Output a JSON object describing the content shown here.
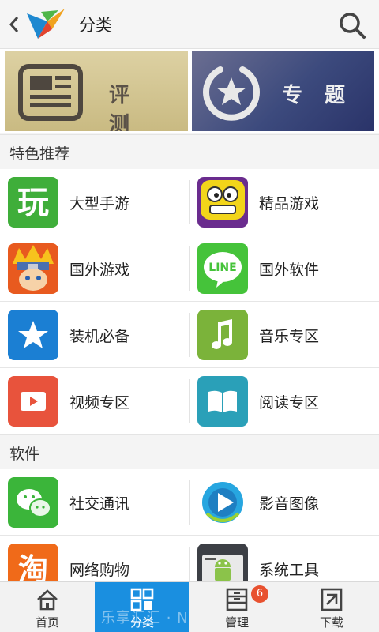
{
  "header": {
    "title": "分类"
  },
  "banners": [
    {
      "label": "评测",
      "icon": "news-icon"
    },
    {
      "label": "专题",
      "icon": "star-badge-icon"
    }
  ],
  "sections": {
    "featured": {
      "title": "特色推荐",
      "items": [
        {
          "label": "大型手游",
          "icon": "play-char-icon"
        },
        {
          "label": "精品游戏",
          "icon": "cartoon-face-icon"
        },
        {
          "label": "国外游戏",
          "icon": "ninja-avatar-icon"
        },
        {
          "label": "国外软件",
          "icon": "line-app-icon"
        },
        {
          "label": "装机必备",
          "icon": "star-icon"
        },
        {
          "label": "音乐专区",
          "icon": "music-note-icon"
        },
        {
          "label": "视频专区",
          "icon": "video-play-icon"
        },
        {
          "label": "阅读专区",
          "icon": "book-icon"
        }
      ]
    },
    "software": {
      "title": "软件",
      "items": [
        {
          "label": "社交通讯",
          "icon": "chat-bubbles-icon"
        },
        {
          "label": "影音图像",
          "icon": "media-play-icon"
        },
        {
          "label": "网络购物",
          "icon": "shop-char-icon"
        },
        {
          "label": "系统工具",
          "icon": "android-tools-icon"
        }
      ]
    }
  },
  "nav": {
    "items": [
      {
        "label": "首页",
        "icon": "home-icon"
      },
      {
        "label": "分类",
        "icon": "category-grid-icon",
        "active": true
      },
      {
        "label": "管理",
        "icon": "manage-icon",
        "badge": "6"
      },
      {
        "label": "下载",
        "icon": "download-icon"
      }
    ]
  },
  "watermark": "乐享汇汇 · N",
  "colors": {
    "accent": "#1a8fe0",
    "badge": "#e8512f"
  }
}
